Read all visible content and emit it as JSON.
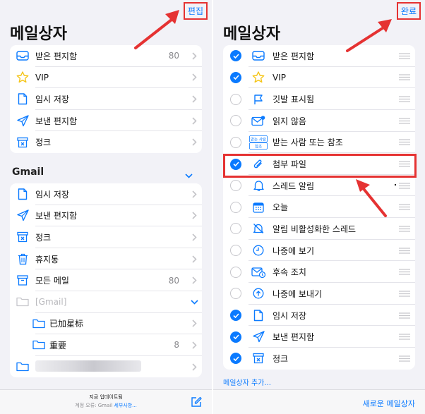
{
  "left": {
    "edit_label": "편집",
    "title": "메일상자",
    "mailboxes": [
      {
        "label": "받은 편지함",
        "count": "80",
        "icon": "inbox-icon"
      },
      {
        "label": "VIP",
        "count": "",
        "icon": "star-icon"
      },
      {
        "label": "임시 저장",
        "count": "",
        "icon": "draft-icon"
      },
      {
        "label": "보낸 편지함",
        "count": "",
        "icon": "sent-icon"
      },
      {
        "label": "정크",
        "count": "",
        "icon": "junk-icon"
      }
    ],
    "account_name": "Gmail",
    "account_items": [
      {
        "label": "임시 저장",
        "count": "",
        "icon": "draft-icon"
      },
      {
        "label": "보낸 편지함",
        "count": "",
        "icon": "sent-icon"
      },
      {
        "label": "정크",
        "count": "",
        "icon": "junk-icon"
      },
      {
        "label": "휴지통",
        "count": "",
        "icon": "trash-icon"
      },
      {
        "label": "모든 메일",
        "count": "80",
        "icon": "archive-icon"
      },
      {
        "label": "[Gmail]",
        "count": "",
        "icon": "folder-icon"
      },
      {
        "label": "已加星标",
        "count": "",
        "icon": "folder-icon"
      },
      {
        "label": "重要",
        "count": "8",
        "icon": "folder-icon"
      }
    ],
    "status": "지금 업데이트됨",
    "error_prefix": "계정 오류: Gmail",
    "error_link": "세부사항..."
  },
  "right": {
    "done_label": "완료",
    "title": "메일상자",
    "rows": [
      {
        "label": "받은 편지함",
        "checked": true,
        "icon": "inbox-icon"
      },
      {
        "label": "VIP",
        "checked": true,
        "icon": "star-icon"
      },
      {
        "label": "깃발 표시됨",
        "checked": false,
        "icon": "flag-icon"
      },
      {
        "label": "읽지 않음",
        "checked": false,
        "icon": "unread-icon"
      },
      {
        "label": "받는 사람 또는 참조",
        "checked": false,
        "icon": "to-cc-icon"
      },
      {
        "label": "첨부 파일",
        "checked": true,
        "icon": "attachment-icon"
      },
      {
        "label": "스레드 알림",
        "checked": false,
        "icon": "bell-icon"
      },
      {
        "label": "오늘",
        "checked": false,
        "icon": "calendar-icon"
      },
      {
        "label": "알림 비활성화한 스레드",
        "checked": false,
        "icon": "bell-slash-icon"
      },
      {
        "label": "나중에 보기",
        "checked": false,
        "icon": "clock-icon"
      },
      {
        "label": "후속 조치",
        "checked": false,
        "icon": "follow-up-icon"
      },
      {
        "label": "나중에 보내기",
        "checked": false,
        "icon": "send-later-icon"
      },
      {
        "label": "임시 저장",
        "checked": true,
        "icon": "draft-icon"
      },
      {
        "label": "보낸 편지함",
        "checked": true,
        "icon": "sent-icon"
      },
      {
        "label": "정크",
        "checked": true,
        "icon": "junk-icon"
      }
    ],
    "to_cc_badge_top": "받는 사람",
    "to_cc_badge_bottom": "참조",
    "add_mailbox": "메일상자 추가...",
    "new_mailbox": "새로운 메일상자"
  },
  "colors": {
    "accent": "#0a7aff",
    "highlight": "#e53232",
    "background": "#f2f2f7"
  }
}
